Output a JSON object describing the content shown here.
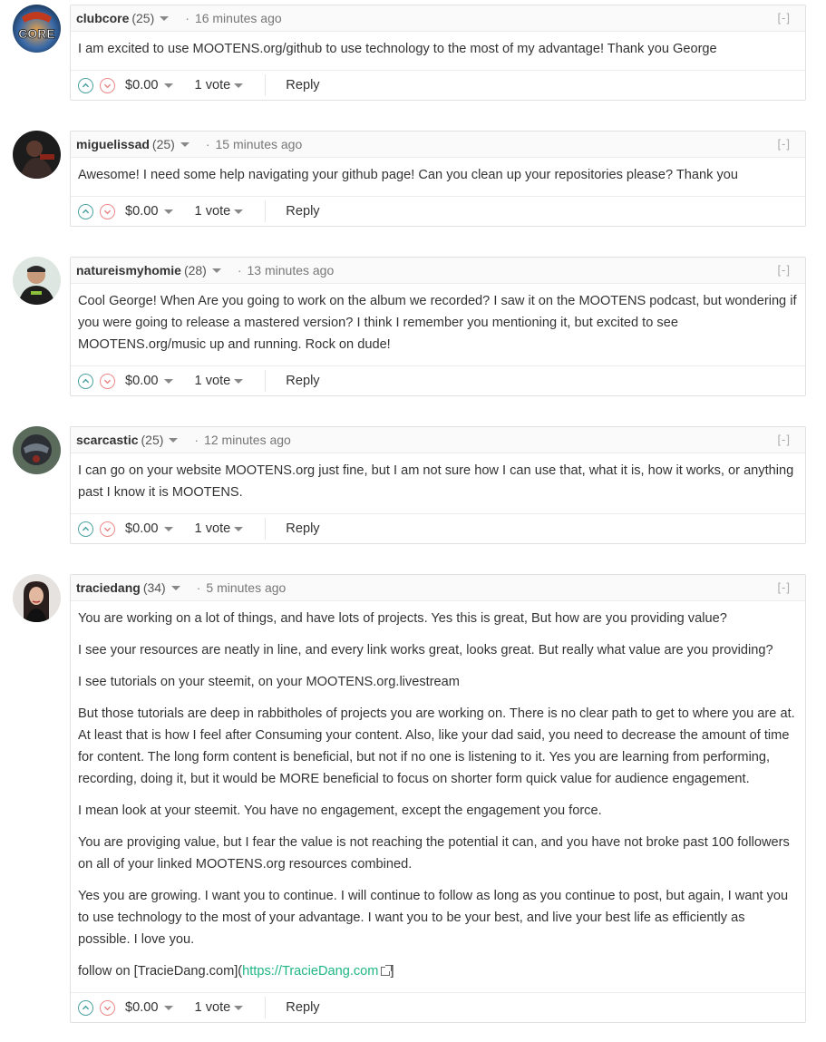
{
  "comments": [
    {
      "author": "clubcore",
      "reputation": "(25)",
      "time": "16 minutes ago",
      "collapse": "[-]",
      "paragraphs": [
        "I am excited to use MOOTENS.org/github to use technology to the most of my advantage! Thank you George"
      ],
      "payout": "$0.00",
      "votes": "1 vote",
      "reply": "Reply"
    },
    {
      "author": "miguelissad",
      "reputation": "(25)",
      "time": "15 minutes ago",
      "collapse": "[-]",
      "paragraphs": [
        "Awesome! I need some help navigating your github page! Can you clean up your repositories please? Thank you"
      ],
      "payout": "$0.00",
      "votes": "1 vote",
      "reply": "Reply"
    },
    {
      "author": "natureismyhomie",
      "reputation": "(28)",
      "time": "13 minutes ago",
      "collapse": "[-]",
      "paragraphs": [
        "Cool George! When Are you going to work on the album we recorded? I saw it on the MOOTENS podcast, but wondering if you were going to release a mastered version? I think I remember you mentioning it, but excited to see MOOTENS.org/music up and running. Rock on dude!"
      ],
      "payout": "$0.00",
      "votes": "1 vote",
      "reply": "Reply"
    },
    {
      "author": "scarcastic",
      "reputation": "(25)",
      "time": "12 minutes ago",
      "collapse": "[-]",
      "paragraphs": [
        "I can go on your website MOOTENS.org just fine, but I am not sure how I can use that, what it is, how it works, or anything past I know it is MOOTENS."
      ],
      "payout": "$0.00",
      "votes": "1 vote",
      "reply": "Reply"
    },
    {
      "author": "traciedang",
      "reputation": "(34)",
      "time": "5 minutes ago",
      "collapse": "[-]",
      "paragraphs": [
        "You are working on a lot of things, and have lots of projects. Yes this is great, But how are you providing value?",
        "I see your resources are neatly in line, and every link works great, looks great. But really what value are you providing?",
        "I see tutorials on your steemit, on your MOOTENS.org.livestream",
        "But those tutorials are deep in rabbitholes of projects you are working on. There is no clear path to get to where you are at. At least that is how I feel after Consuming your content. Also, like your dad said, you need to decrease the amount of time for content. The long form content is beneficial, but not if no one is listening to it. Yes you are learning from performing, recording, doing it, but it would be MORE beneficial to focus on shorter form quick value for audience engagement.",
        "I mean look at your steemit. You have no engagement, except the engagement you force.",
        "You are proviging value, but I fear the value is not reaching the potential it can, and you have not broke past 100 followers on all of your linked MOOTENS.org resources combined.",
        "Yes you are growing. I want you to continue. I will continue to follow as long as you continue to post, but again, I want you to use technology to the most of your advantage. I want you to be your best, and live your best life as efficiently as possible. I love you."
      ],
      "follow_prefix": "follow on [TracieDang.com](",
      "follow_link": "https://TracieDang.com",
      "follow_suffix": "]",
      "payout": "$0.00",
      "votes": "1 vote",
      "reply": "Reply"
    }
  ],
  "avatar_labels": {
    "clubcore": "CORE"
  },
  "colors": {
    "link": "#1fb686",
    "upvote": "#4ba2a0",
    "downvote": "#e88888"
  }
}
